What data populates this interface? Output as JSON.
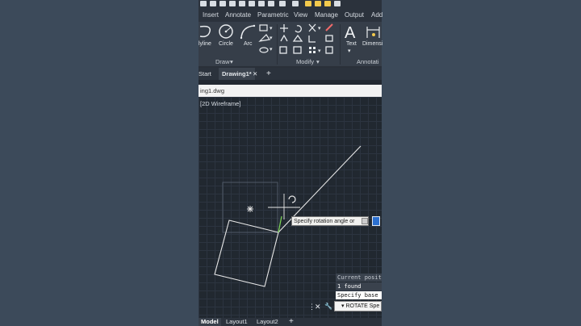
{
  "menu": [
    "Insert",
    "Annotate",
    "Parametric",
    "View",
    "Manage",
    "Output",
    "Add"
  ],
  "ribbon": {
    "tools": {
      "polyline": "lyline",
      "circle": "Circle",
      "arc": "Arc",
      "text": "Text",
      "dimension": "Dimensi"
    },
    "panels": {
      "draw": "Draw",
      "modify": "Modify",
      "annotation": "Annotati"
    },
    "dropdown_glyph": "▾"
  },
  "file_tabs": {
    "start": "Start",
    "active": "Drawing1*",
    "close": "✕",
    "add": "+"
  },
  "document_title": "ing1.dwg",
  "viewport_label": "[2D Wireframe]",
  "rotate_prompt": "Specify rotation angle or",
  "command_history": [
    "Current posit",
    "1 found",
    "Specify base"
  ],
  "command_line": {
    "icons": [
      "⋮",
      "✕",
      "🔧"
    ],
    "prompt_marker": "▾",
    "command": "ROTATE Spe"
  },
  "layout_tabs": {
    "model": "Model",
    "layout1": "Layout1",
    "layout2": "Layout2",
    "add": "+"
  },
  "colors": {
    "background": "#3c4a5a",
    "workspace": "#212830",
    "ribbon": "#363e49",
    "geometry": "#e8e8e8",
    "rubberband": "#7ed957",
    "accent": "#2b6fcf"
  }
}
